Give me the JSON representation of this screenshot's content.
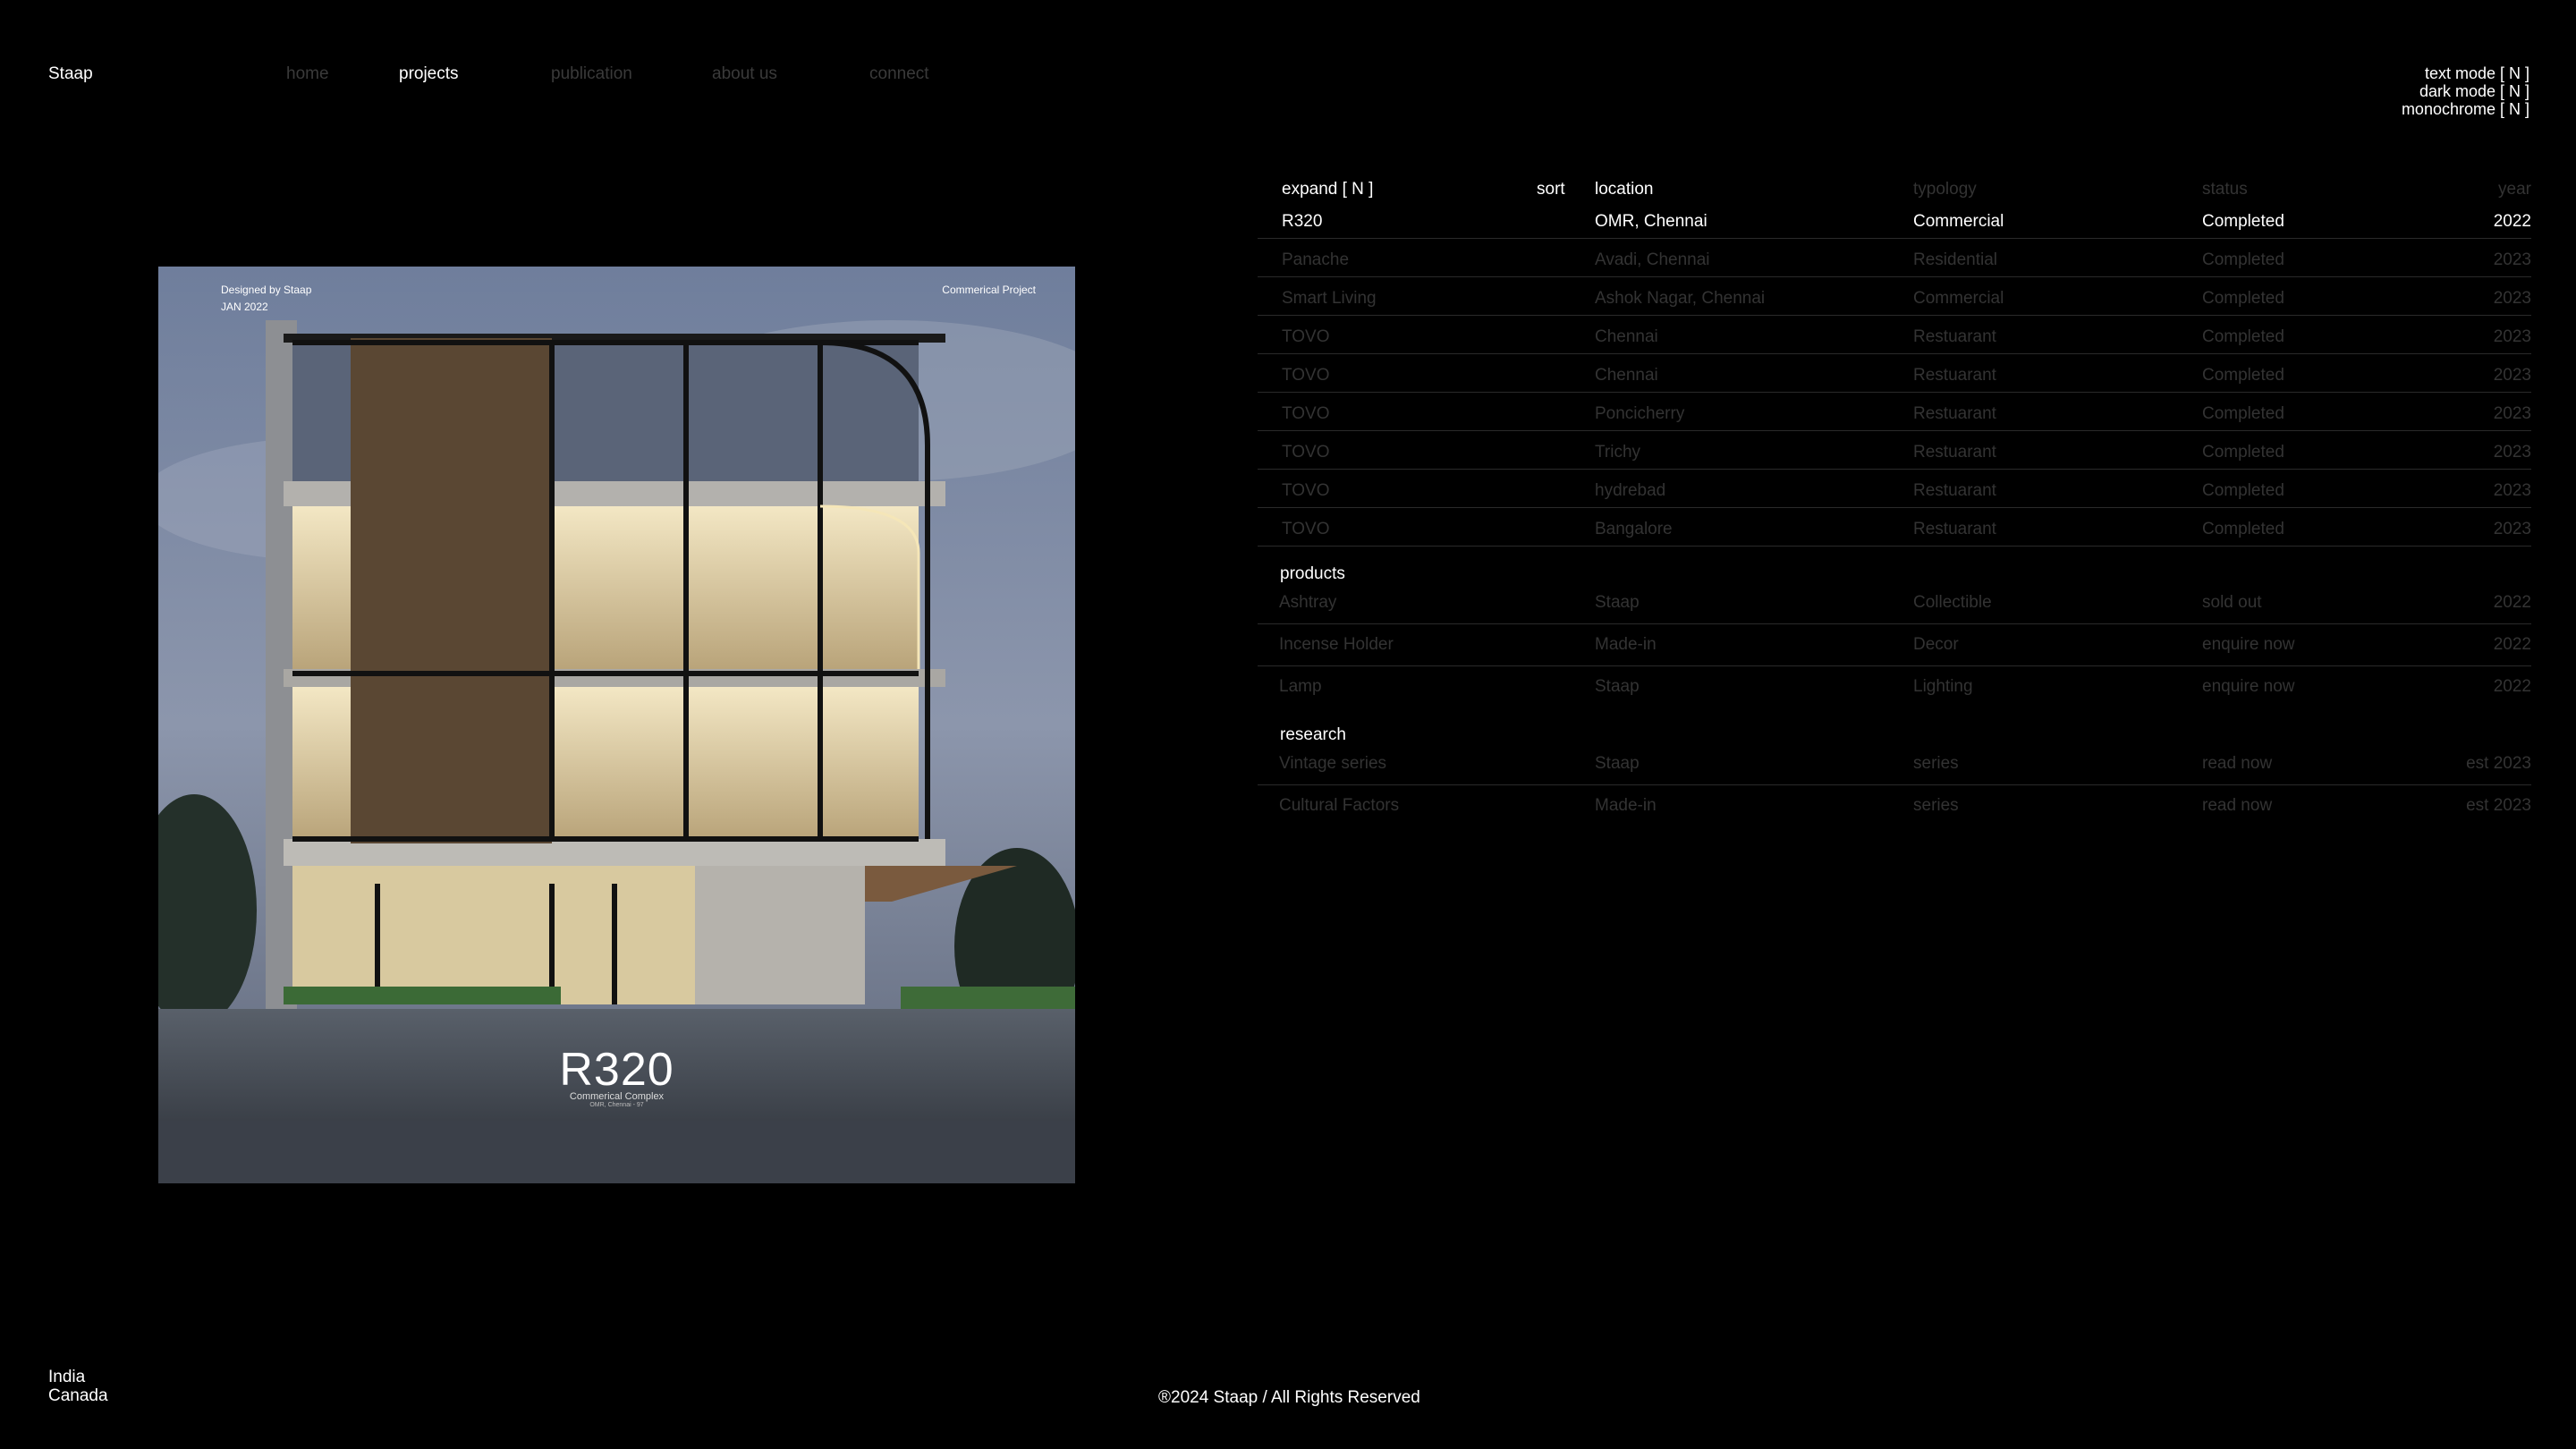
{
  "brand": "Staap",
  "nav": [
    {
      "label": "home",
      "active": false
    },
    {
      "label": "projects",
      "active": true
    },
    {
      "label": "publication",
      "active": false
    },
    {
      "label": "about us",
      "active": false
    },
    {
      "label": "connect",
      "active": false
    }
  ],
  "modes": [
    "text mode  [ N ]",
    "dark mode  [ N ]",
    "monochrome  [ N ]"
  ],
  "hero": {
    "designed_by": "Designed by Staap",
    "date": "JAN 2022",
    "tag": "Commerical Project",
    "title": "R320",
    "subtitle": "Commerical Complex",
    "subtitle2": "OMR, Chennai - 97"
  },
  "table": {
    "headers": {
      "expand": "expand  [ N ]",
      "sort": "sort",
      "location": "location",
      "typology": "typology",
      "status": "status",
      "year": "year"
    },
    "projects": [
      {
        "name": "R320",
        "location": "OMR, Chennai",
        "typology": "Commercial",
        "status": "Completed",
        "year": "2022",
        "active": true
      },
      {
        "name": "Panache",
        "location": "Avadi, Chennai",
        "typology": "Residential",
        "status": "Completed",
        "year": "2023"
      },
      {
        "name": "Smart Living",
        "location": "Ashok Nagar, Chennai",
        "typology": "Commercial",
        "status": "Completed",
        "year": "2023"
      },
      {
        "name": "TOVO",
        "location": "Chennai",
        "typology": "Restuarant",
        "status": "Completed",
        "year": "2023"
      },
      {
        "name": "TOVO",
        "location": "Chennai",
        "typology": "Restuarant",
        "status": "Completed",
        "year": "2023"
      },
      {
        "name": "TOVO",
        "location": "Poncicherry",
        "typology": "Restuarant",
        "status": "Completed",
        "year": "2023"
      },
      {
        "name": "TOVO",
        "location": "Trichy",
        "typology": "Restuarant",
        "status": "Completed",
        "year": "2023"
      },
      {
        "name": "TOVO",
        "location": "hydrebad",
        "typology": "Restuarant",
        "status": "Completed",
        "year": "2023"
      },
      {
        "name": "TOVO",
        "location": "Bangalore",
        "typology": "Restuarant",
        "status": "Completed",
        "year": "2023"
      }
    ],
    "products_title": "products",
    "products": [
      {
        "name": "Ashtray",
        "location": "Staap",
        "typology": "Collectible",
        "status": "sold out",
        "year": "2022"
      },
      {
        "name": "Incense Holder",
        "location": "Made-in",
        "typology": "Decor",
        "status": "enquire now",
        "year": "2022"
      },
      {
        "name": "Lamp",
        "location": "Staap",
        "typology": "Lighting",
        "status": "enquire now",
        "year": "2022"
      }
    ],
    "research_title": "research",
    "research": [
      {
        "name": "Vintage series",
        "location": "Staap",
        "typology": "series",
        "status": "read now",
        "year": "est 2023"
      },
      {
        "name": "Cultural Factors",
        "location": "Made-in",
        "typology": "series",
        "status": "read now",
        "year": "est 2023"
      }
    ]
  },
  "footer": {
    "locations": [
      "India",
      "Canada"
    ],
    "copyright": "®2024 Staap / All Rights Reserved"
  },
  "colors": {
    "background": "#000000",
    "text": "#ffffff",
    "dim": "#333333"
  }
}
